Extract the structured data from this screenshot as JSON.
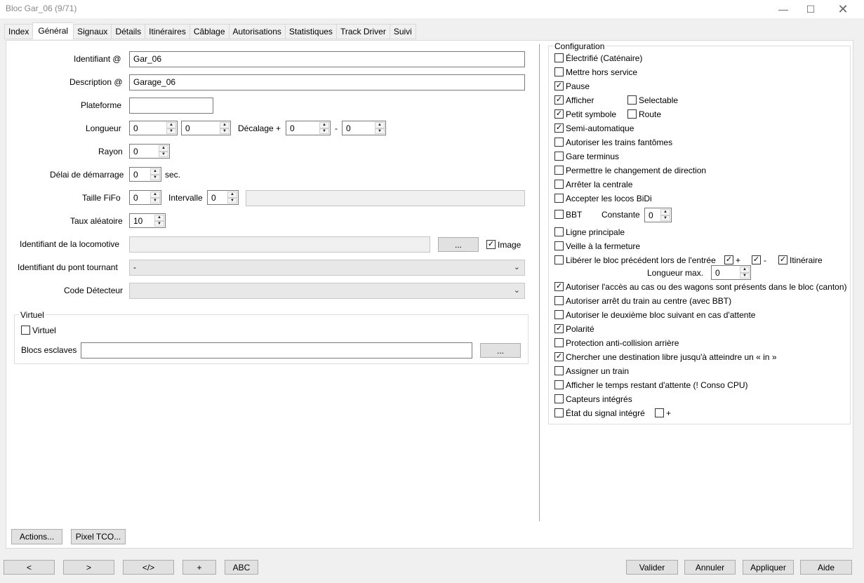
{
  "window": {
    "title": "Bloc Gar_06 (9/71)",
    "minimize_icon": "minimize-icon",
    "maximize_icon": "maximize-icon",
    "close_icon": "close-icon"
  },
  "tabs": [
    "Index",
    "Général",
    "Signaux",
    "Détails",
    "Itinéraires",
    "Câblage",
    "Autorisations",
    "Statistiques",
    "Track Driver",
    "Suivi"
  ],
  "active_tab": "Général",
  "general": {
    "identifiant_label": "Identifiant @",
    "identifiant_value": "Gar_06",
    "description_label": "Description @",
    "description_value": "Garage_06",
    "plateforme_label": "Plateforme",
    "plateforme_value": "",
    "longueur_label": "Longueur",
    "longueur_value1": "0",
    "longueur_value2": "0",
    "decalage_label": "Décalage +",
    "decalage_plus_value": "0",
    "decalage_minus_label": "-",
    "decalage_minus_value": "0",
    "rayon_label": "Rayon",
    "rayon_value": "0",
    "delai_label": "Délai de démarrage",
    "delai_value": "0",
    "delai_unit": "sec.",
    "fifo_label": "Taille  FiFo",
    "fifo_value": "0",
    "intervalle_label": "Intervalle",
    "intervalle_value": "0",
    "taux_label": "Taux aléatoire",
    "taux_value": "10",
    "loco_label": "Identifiant de la locomotive",
    "loco_value": "",
    "browse_label": "...",
    "image_label": "Image",
    "pont_label": "Identifiant du pont tournant",
    "pont_value": "-",
    "detecteur_label": "Code Détecteur",
    "detecteur_value": ""
  },
  "virtuel": {
    "group_title": "Virtuel",
    "checkbox_label": "Virtuel",
    "blocs_label": "Blocs esclaves",
    "blocs_value": "",
    "browse_label": "..."
  },
  "configuration": {
    "title": "Configuration",
    "items": [
      {
        "label": "Électrifié (Caténaire)",
        "checked": false
      },
      {
        "label": "Mettre hors service",
        "checked": false
      },
      {
        "label": "Pause",
        "checked": true
      },
      {
        "label": "Afficher",
        "checked": true
      },
      {
        "label": "Petit symbole",
        "checked": true
      },
      {
        "label": "Semi-automatique",
        "checked": true
      },
      {
        "label": "Autoriser les trains fantômes",
        "checked": false
      },
      {
        "label": "Gare terminus",
        "checked": false
      },
      {
        "label": "Permettre le changement de direction",
        "checked": false
      },
      {
        "label": "Arrêter la centrale",
        "checked": false
      },
      {
        "label": "Accepter les locos BiDi",
        "checked": false
      },
      {
        "label": "BBT",
        "checked": false
      },
      {
        "label": "Ligne principale",
        "checked": false
      },
      {
        "label": "Veille à la fermeture",
        "checked": false
      },
      {
        "label": "Libérer le bloc précédent lors de l'entrée",
        "checked": false
      },
      {
        "label": "Autoriser l'accès au cas ou des wagons sont présents dans le bloc (canton)",
        "checked": true
      },
      {
        "label": "Autoriser arrêt du train au centre (avec BBT)",
        "checked": false
      },
      {
        "label": "Autoriser le deuxième bloc suivant en cas d'attente",
        "checked": false
      },
      {
        "label": "Polarité",
        "checked": true
      },
      {
        "label": "Protection anti-collision arrière",
        "checked": false
      },
      {
        "label": "Chercher une destination libre jusqu'à atteindre un « in »",
        "checked": true
      },
      {
        "label": "Assigner un train",
        "checked": false
      },
      {
        "label": "Afficher le temps restant d'attente (! Conso CPU)",
        "checked": false
      },
      {
        "label": "Capteurs intégrés",
        "checked": false
      },
      {
        "label": "État du signal intégré",
        "checked": false
      }
    ],
    "selectable_label": "Selectable",
    "selectable_checked": false,
    "route_label": "Route",
    "route_checked": false,
    "constante_label": "Constante",
    "constante_value": "0",
    "liberer_plus_label": "+",
    "liberer_minus_label": "-",
    "itineraire_label": "Itinéraire",
    "longueur_max_label": "Longueur max.",
    "longueur_max_value": "0",
    "signal_plus_label": "+"
  },
  "panel_buttons": {
    "actions": "Actions...",
    "pixel_tco": "Pixel TCO..."
  },
  "footer": {
    "prev": "<",
    "next": ">",
    "code": "</>",
    "add": "+",
    "abc": "ABC",
    "valider": "Valider",
    "annuler": "Annuler",
    "appliquer": "Appliquer",
    "aide": "Aide"
  }
}
